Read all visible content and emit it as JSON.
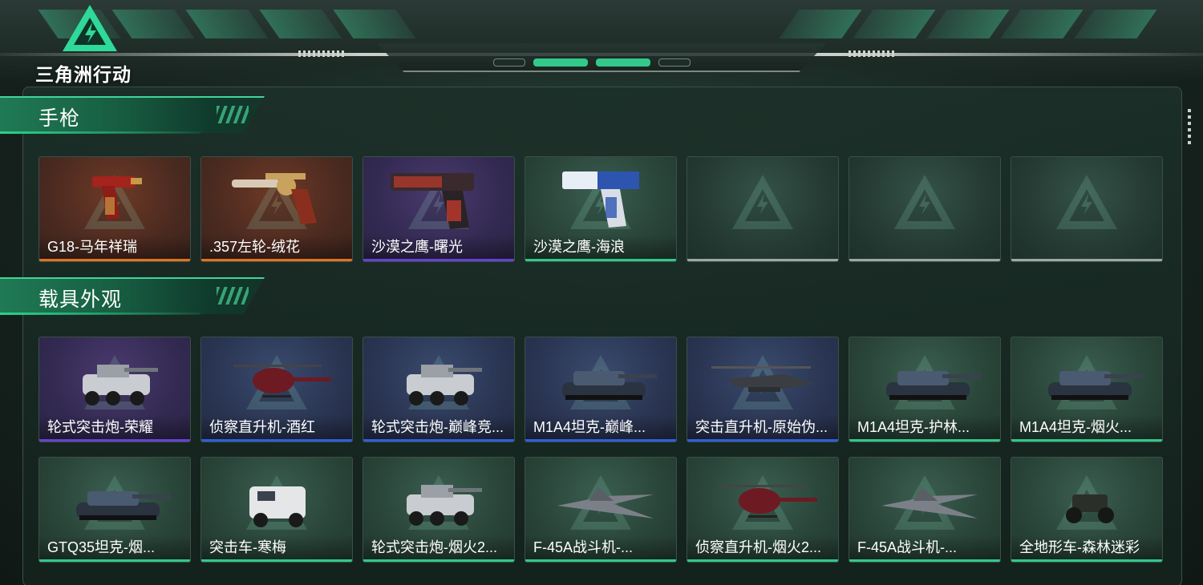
{
  "game_logo": {
    "text": "三角洲行动"
  },
  "colors": {
    "accent": "#2bd18c",
    "rarity_orange": "#e2731f",
    "rarity_purple": "#6a3fd6",
    "rarity_blue": "#2f5ee0",
    "rarity_green": "#2ec98a",
    "rarity_empty": "#9ea7a2"
  },
  "sections": [
    {
      "title": "手枪",
      "items": [
        {
          "name": "G18-马年祥瑞",
          "rarity": "orange",
          "icon": "pistol-red-gold"
        },
        {
          "name": ".357左轮-绒花",
          "rarity": "orange",
          "icon": "revolver-gold"
        },
        {
          "name": "沙漠之鹰-曙光",
          "rarity": "purple",
          "icon": "deagle-red-black"
        },
        {
          "name": "沙漠之鹰-海浪",
          "rarity": "green",
          "icon": "deagle-blue-white"
        },
        {
          "name": "",
          "rarity": "empty",
          "icon": "empty-slot"
        },
        {
          "name": "",
          "rarity": "empty",
          "icon": "empty-slot"
        },
        {
          "name": "",
          "rarity": "empty",
          "icon": "empty-slot"
        }
      ]
    },
    {
      "title": "载具外观",
      "items": [
        {
          "name": "轮式突击炮-荣耀",
          "rarity": "purple",
          "icon": "wheeled-assault-gun"
        },
        {
          "name": "侦察直升机-酒红",
          "rarity": "blue",
          "icon": "scout-helicopter"
        },
        {
          "name": "轮式突击炮-巅峰竞...",
          "rarity": "blue",
          "icon": "wheeled-assault-gun"
        },
        {
          "name": "M1A4坦克-巅峰...",
          "rarity": "blue",
          "icon": "tank"
        },
        {
          "name": "突击直升机-原始伪...",
          "rarity": "blue",
          "icon": "attack-helicopter"
        },
        {
          "name": "M1A4坦克-护林...",
          "rarity": "green",
          "icon": "tank"
        },
        {
          "name": "M1A4坦克-烟火...",
          "rarity": "green",
          "icon": "tank"
        },
        {
          "name": "GTQ35坦克-烟...",
          "rarity": "green",
          "icon": "tank"
        },
        {
          "name": "突击车-寒梅",
          "rarity": "green",
          "icon": "assault-vehicle"
        },
        {
          "name": "轮式突击炮-烟火2...",
          "rarity": "green",
          "icon": "wheeled-assault-gun"
        },
        {
          "name": "F-45A战斗机-...",
          "rarity": "green",
          "icon": "fighter-jet"
        },
        {
          "name": "侦察直升机-烟火2...",
          "rarity": "green",
          "icon": "scout-helicopter"
        },
        {
          "name": "F-45A战斗机-...",
          "rarity": "green",
          "icon": "fighter-jet"
        },
        {
          "name": "全地形车-森林迷彩",
          "rarity": "green",
          "icon": "atv"
        }
      ]
    }
  ]
}
